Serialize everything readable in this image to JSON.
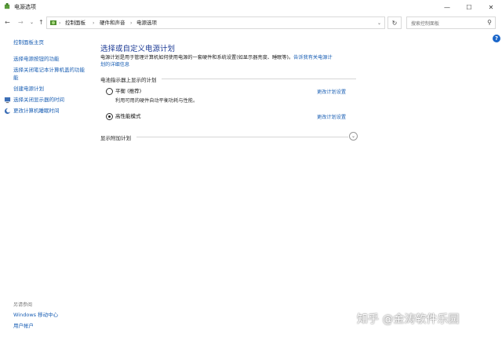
{
  "window": {
    "title": "电源选项",
    "minimize_glyph": "—",
    "maximize_glyph": "☐",
    "close_glyph": "✕"
  },
  "nav": {
    "back_glyph": "←",
    "forward_glyph": "→",
    "recent_glyph": "⌄",
    "up_glyph": "↑",
    "refresh_glyph": "↻"
  },
  "breadcrumb": [
    "控制面板",
    "硬件和声音",
    "电源选项"
  ],
  "search": {
    "placeholder": "搜索控制面板"
  },
  "sidebar": {
    "home": "控制面板主页",
    "links": [
      "选择电源按钮的功能",
      "选择关闭笔记本计算机盖的功能",
      "能",
      "创建电源计划",
      "选择关闭显示器的时间",
      "更改计算机睡眠时间"
    ],
    "see_also_title": "另请参阅",
    "see_also": [
      "Windows 移动中心",
      "用户帐户"
    ]
  },
  "main": {
    "title": "选择或自定义电源计划",
    "desc_line1": "电源计划是用于管理计算机如何使用电源的一套硬件和系统设置(如显示器亮度、睡眠等)。",
    "desc_link_a": "告诉我有关电源计",
    "desc_link_b": "划的详细信息",
    "section_title": "电池指示器上显示的计划",
    "plans": [
      {
        "name": "平衡 (推荐)",
        "desc": "利用可用的硬件自动平衡功耗与性能。",
        "settings": "更改计划设置",
        "selected": false
      },
      {
        "name": "高性能模式",
        "desc": "",
        "settings": "更改计划设置",
        "selected": true
      }
    ],
    "more_plans": "显示附加计划",
    "expand_glyph": "⌄"
  },
  "help": {
    "glyph": "?"
  },
  "watermark": "知乎 @金涛软件乐园",
  "colors": {
    "link": "#1a5fb4",
    "title": "#1e3c96",
    "help": "#1a66c9"
  }
}
